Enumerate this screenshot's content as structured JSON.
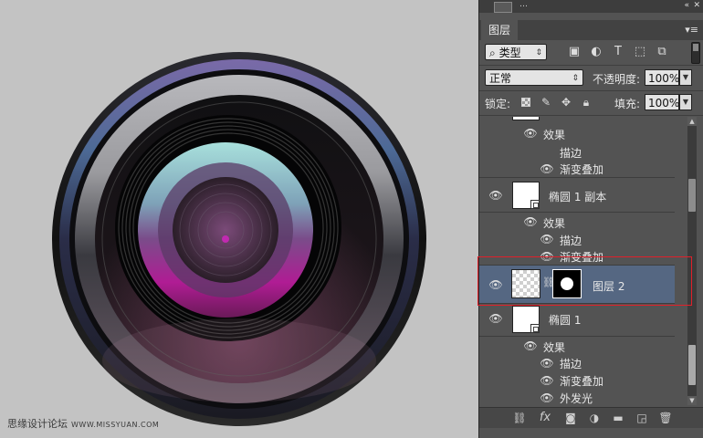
{
  "watermark": {
    "text": "思缘设计论坛",
    "url": "WWW.MISSYUAN.COM"
  },
  "panel": {
    "top_stub_text": "…",
    "collapse_icon": "double-chevron-left-icon",
    "close_icon": "close-icon",
    "tab_label": "图层",
    "menu_icon": "panel-menu-icon",
    "filter": {
      "search_icon": "search-icon",
      "kind_value": "类型",
      "icons": [
        "image-filter-icon",
        "adjustment-filter-icon",
        "type-filter-icon",
        "shape-filter-icon",
        "smart-object-filter-icon"
      ]
    },
    "blend": {
      "mode_value": "正常",
      "opacity_label": "不透明度:",
      "opacity_value": "100%"
    },
    "lock": {
      "label": "锁定:",
      "fill_label": "填充:",
      "fill_value": "100%"
    },
    "layers_top": [
      {
        "label": "效果",
        "type": "effects-header"
      },
      {
        "label": "描边",
        "type": "effect"
      },
      {
        "label": "渐变叠加",
        "type": "effect"
      }
    ],
    "layer_copy": {
      "name": "椭圆 1 副本",
      "fx": "fx",
      "effects_label": "效果",
      "effects": [
        "描边",
        "渐变叠加"
      ]
    },
    "layer_selected": {
      "name": "图层 2"
    },
    "layer_base": {
      "name": "椭圆 1",
      "fx": "fx",
      "effects_label": "效果",
      "effects": [
        "描边",
        "渐变叠加",
        "外发光"
      ]
    },
    "bottom_icons": [
      "link-layers-icon",
      "fx-icon",
      "add-mask-icon",
      "adjustment-layer-icon",
      "new-group-icon",
      "new-layer-icon",
      "trash-icon"
    ],
    "bottom_fx_label": "fx"
  },
  "colors": {
    "panel_bg": "#535353",
    "selected_row": "#556782",
    "highlight_border": "#e0202a",
    "canvas_bg": "#c3c3c3"
  }
}
